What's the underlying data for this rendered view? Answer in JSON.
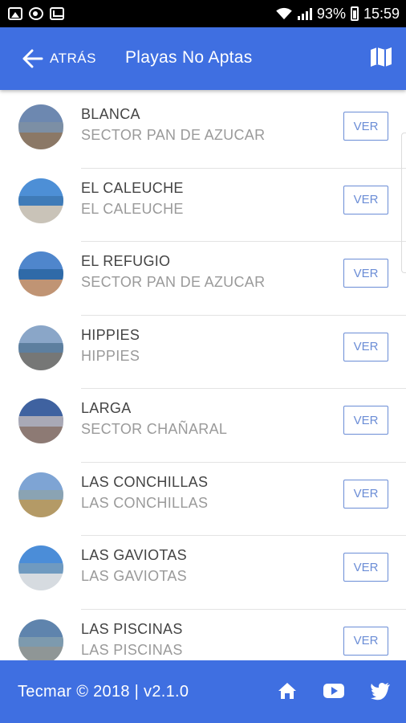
{
  "status_bar": {
    "battery": "93%",
    "time": "15:59"
  },
  "header": {
    "back_label": "ATRÁS",
    "title": "Playas No Aptas"
  },
  "beaches": [
    {
      "name": "BLANCA",
      "sector": "SECTOR PAN DE AZUCAR",
      "button": "VER",
      "sky": "#6d88b0",
      "sea": "#7c8fa5",
      "sand": "#8b7866"
    },
    {
      "name": "EL CALEUCHE",
      "sector": "EL CALEUCHE",
      "button": "VER",
      "sky": "#4d8fd6",
      "sea": "#3f7bb8",
      "sand": "#c9c3b8"
    },
    {
      "name": "EL REFUGIO",
      "sector": "SECTOR PAN DE AZUCAR",
      "button": "VER",
      "sky": "#4f86cc",
      "sea": "#2f6aa8",
      "sand": "#c09474"
    },
    {
      "name": "HIPPIES",
      "sector": "HIPPIES",
      "button": "VER",
      "sky": "#8aa6c8",
      "sea": "#5d7f9f",
      "sand": "#767776"
    },
    {
      "name": "LARGA",
      "sector": "SECTOR CHAÑARAL",
      "button": "VER",
      "sky": "#3f62a0",
      "sea": "#a9a9b6",
      "sand": "#8d7a74"
    },
    {
      "name": "LAS CONCHILLAS",
      "sector": "LAS CONCHILLAS",
      "button": "VER",
      "sky": "#7ea4d4",
      "sea": "#8aa3b3",
      "sand": "#b49a66"
    },
    {
      "name": "LAS GAVIOTAS",
      "sector": "LAS GAVIOTAS",
      "button": "VER",
      "sky": "#4b8dd8",
      "sea": "#6f9ac0",
      "sand": "#d6dbe0"
    },
    {
      "name": "LAS PISCINAS",
      "sector": "LAS PISCINAS",
      "button": "VER",
      "sky": "#5f84ad",
      "sea": "#7d9aae",
      "sand": "#8f9696"
    }
  ],
  "footer": {
    "text": "Tecmar © 2018 | v2.1.0"
  },
  "colors": {
    "primary": "#3f6fe1",
    "button_border": "#6b8dd6"
  },
  "icons": {
    "back": "arrow-left-icon",
    "map": "map-icon",
    "home": "home-icon",
    "youtube": "youtube-icon",
    "twitter": "twitter-icon"
  }
}
